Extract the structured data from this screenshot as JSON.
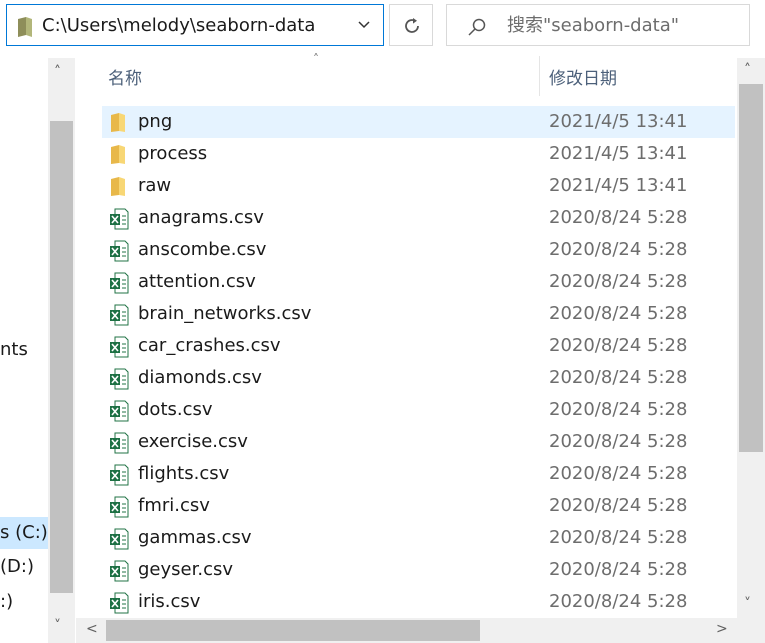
{
  "address": {
    "path": "C:\\Users\\melody\\seaborn-data"
  },
  "search": {
    "placeholder": "搜索\"seaborn-data\""
  },
  "nav": {
    "items": [
      {
        "label": "nts"
      },
      {
        "label": "s (C:)"
      },
      {
        "label": " (D:)"
      },
      {
        "label": ":)"
      }
    ]
  },
  "columns": {
    "name": "名称",
    "date": "修改日期"
  },
  "files": [
    {
      "name": "png",
      "date": "2021/4/5 13:41",
      "type": "folder"
    },
    {
      "name": "process",
      "date": "2021/4/5 13:41",
      "type": "folder"
    },
    {
      "name": "raw",
      "date": "2021/4/5 13:41",
      "type": "folder"
    },
    {
      "name": "anagrams.csv",
      "date": "2020/8/24 5:28",
      "type": "csv"
    },
    {
      "name": "anscombe.csv",
      "date": "2020/8/24 5:28",
      "type": "csv"
    },
    {
      "name": "attention.csv",
      "date": "2020/8/24 5:28",
      "type": "csv"
    },
    {
      "name": "brain_networks.csv",
      "date": "2020/8/24 5:28",
      "type": "csv"
    },
    {
      "name": "car_crashes.csv",
      "date": "2020/8/24 5:28",
      "type": "csv"
    },
    {
      "name": "diamonds.csv",
      "date": "2020/8/24 5:28",
      "type": "csv"
    },
    {
      "name": "dots.csv",
      "date": "2020/8/24 5:28",
      "type": "csv"
    },
    {
      "name": "exercise.csv",
      "date": "2020/8/24 5:28",
      "type": "csv"
    },
    {
      "name": "flights.csv",
      "date": "2020/8/24 5:28",
      "type": "csv"
    },
    {
      "name": "fmri.csv",
      "date": "2020/8/24 5:28",
      "type": "csv"
    },
    {
      "name": "gammas.csv",
      "date": "2020/8/24 5:28",
      "type": "csv"
    },
    {
      "name": "geyser.csv",
      "date": "2020/8/24 5:28",
      "type": "csv"
    },
    {
      "name": "iris.csv",
      "date": "2020/8/24 5:28",
      "type": "csv"
    }
  ],
  "colors": {
    "accent": "#0078d7",
    "selected_row": "#e5f3ff",
    "folder": "#f8d775",
    "excel": "#1d7044"
  }
}
